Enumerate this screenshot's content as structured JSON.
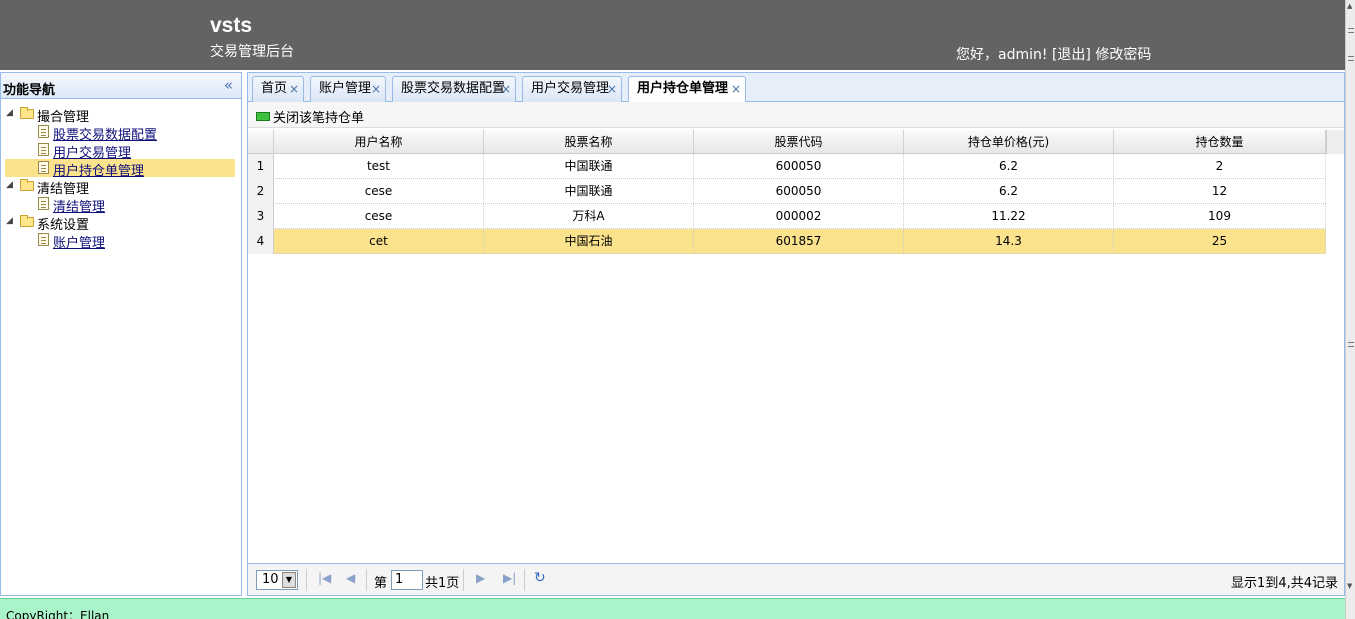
{
  "header": {
    "brand": "vsts",
    "subtitle": "交易管理后台",
    "greeting": "您好，admin!",
    "logout": "[退出]",
    "change_password": "修改密码"
  },
  "nav": {
    "title": "功能导航",
    "groups": [
      {
        "label": "撮合管理",
        "items": [
          "股票交易数据配置",
          "用户交易管理",
          "用户持仓单管理"
        ]
      },
      {
        "label": "清结管理",
        "items": [
          "清结管理"
        ]
      },
      {
        "label": "系统设置",
        "items": [
          "账户管理"
        ]
      }
    ]
  },
  "tabs": [
    {
      "label": "首页",
      "close": "×"
    },
    {
      "label": "账户管理",
      "close": "×"
    },
    {
      "label": "股票交易数据配置",
      "close": "×"
    },
    {
      "label": "用户交易管理",
      "close": "×"
    },
    {
      "label": "用户持仓单管理",
      "close": "×"
    }
  ],
  "toolbar": {
    "close_position_label": "关闭该笔持仓单"
  },
  "grid": {
    "columns": [
      "用户名称",
      "股票名称",
      "股票代码",
      "持仓单价格(元)",
      "持仓数量"
    ],
    "rows": [
      {
        "num": "1",
        "user": "test",
        "stock": "中国联通",
        "code": "600050",
        "price": "6.2",
        "qty": "2"
      },
      {
        "num": "2",
        "user": "cese",
        "stock": "中国联通",
        "code": "600050",
        "price": "6.2",
        "qty": "12"
      },
      {
        "num": "3",
        "user": "cese",
        "stock": "万科A",
        "code": "000002",
        "price": "11.22",
        "qty": "109"
      },
      {
        "num": "4",
        "user": "cet",
        "stock": "中国石油",
        "code": "601857",
        "price": "14.3",
        "qty": "25"
      }
    ]
  },
  "pager": {
    "page_size": "10",
    "page_prefix": "第",
    "page_value": "1",
    "page_total": "共1页",
    "summary": "显示1到4,共4记录"
  },
  "footer": {
    "text": "CopyRight：Ellan"
  }
}
